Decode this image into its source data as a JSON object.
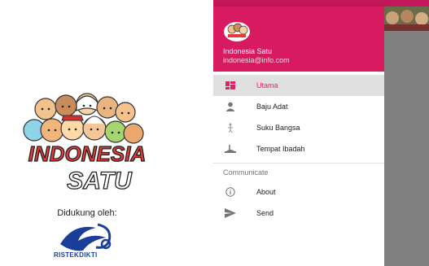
{
  "splash": {
    "logo_text_line1": "INDONESIA",
    "logo_text_line2": "SATU",
    "supported_by": "Didukung oleh:",
    "sponsor": "RISTEKDIKTI"
  },
  "drawer": {
    "profile": {
      "name": "Indonesia Satu",
      "email": "indonesia@info.com"
    },
    "items": [
      {
        "label": "Utama",
        "icon": "dashboard-icon",
        "active": true
      },
      {
        "label": "Baju Adat",
        "icon": "person-icon",
        "active": false
      },
      {
        "label": "Suku Bangsa",
        "icon": "figure-icon",
        "active": false
      },
      {
        "label": "Tempat Ibadah",
        "icon": "landmark-icon",
        "active": false
      }
    ],
    "section_title": "Communicate",
    "section_items": [
      {
        "label": "About",
        "icon": "info-icon"
      },
      {
        "label": "Send",
        "icon": "send-icon"
      }
    ]
  },
  "colors": {
    "header": "#d81b60",
    "accent": "#e91e63",
    "active_bg": "#e0e0e0",
    "scrim": "#808080"
  }
}
